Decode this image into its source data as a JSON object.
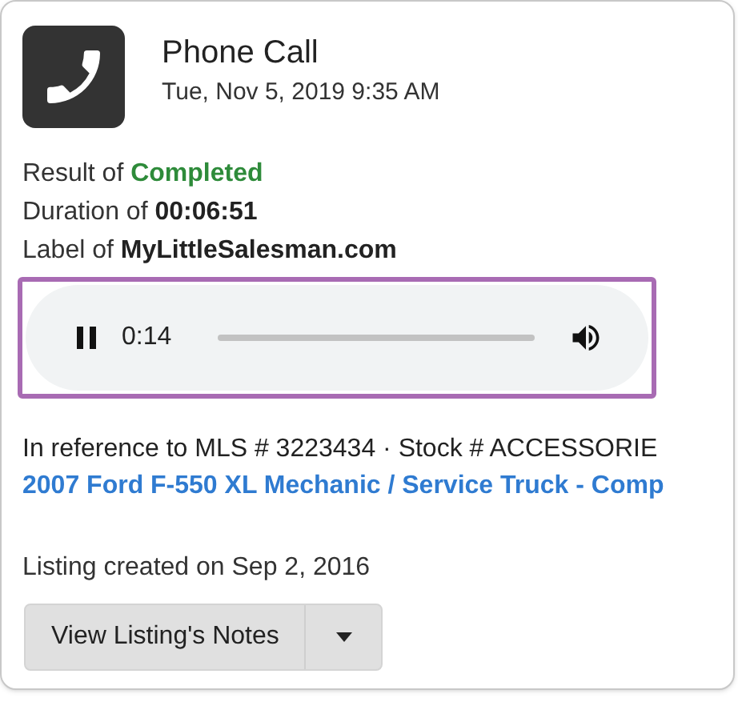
{
  "header": {
    "title": "Phone Call",
    "timestamp": "Tue, Nov 5, 2019 9:35 AM"
  },
  "details": [
    {
      "label": "Result of",
      "value": "Completed",
      "kind": "success"
    },
    {
      "label": "Duration of",
      "value": "00:06:51",
      "kind": "plain"
    },
    {
      "label": "Label of",
      "value": "MyLittleSalesman.com",
      "kind": "plain"
    }
  ],
  "audio_player": {
    "playing": true,
    "time": "0:14",
    "focused": true
  },
  "reference": {
    "text": "In reference to MLS # 3223434 · Stock # ACCESSORIE",
    "link": "2007 Ford F-550 XL Mechanic / Service Truck - Comp"
  },
  "listing_created": "Listing created on Sep 2, 2016",
  "notes_button": {
    "label": "View Listing's Notes"
  }
}
